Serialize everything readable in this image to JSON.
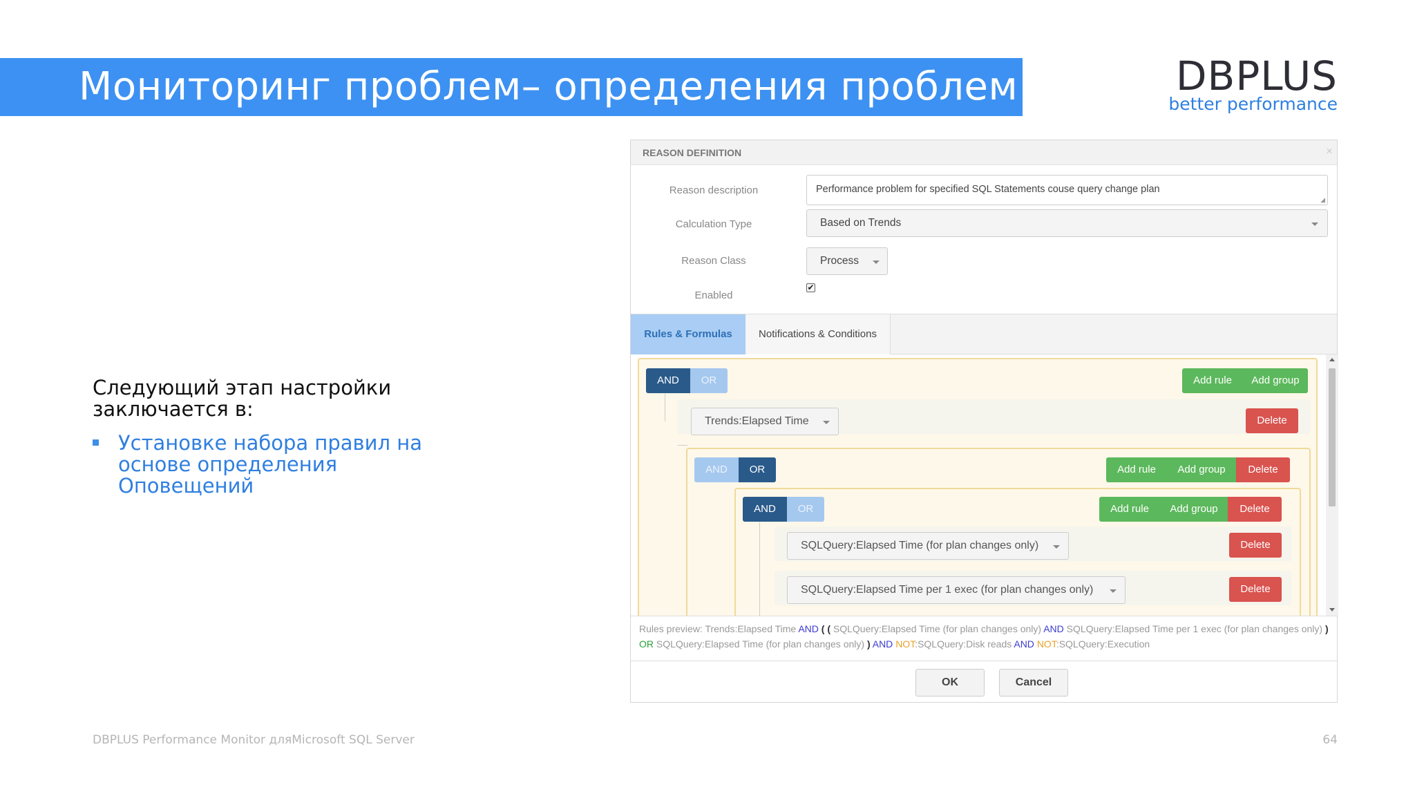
{
  "slide": {
    "title": "Мониторинг проблем– определения проблем",
    "logo_main": "DBPLUS",
    "logo_sub": "better performance",
    "intro_text": "Следующий этап настройки заключается в:",
    "bullet_text": "Установке набора правил на основе определения Оповещений",
    "footer_left": "DBPLUS Performance Monitor дляMicrosoft SQL Server",
    "page_number": "64",
    "accent_color": "#3d91f2"
  },
  "dialog": {
    "title": "REASON DEFINITION",
    "close_icon": "×",
    "fields": {
      "reason_description_label": "Reason description",
      "reason_description_value": "Performance problem for specified SQL Statements couse query change plan",
      "calculation_type_label": "Calculation Type",
      "calculation_type_value": "Based on Trends",
      "reason_class_label": "Reason Class",
      "reason_class_value": "Process",
      "enabled_label": "Enabled",
      "enabled_checked": true,
      "checkmark": "✔"
    },
    "tabs": [
      {
        "label": "Rules & Formulas",
        "active": true
      },
      {
        "label": "Notifications & Conditions",
        "active": false
      }
    ],
    "builder": {
      "root": {
        "and_label": "AND",
        "or_label": "OR",
        "active": "AND",
        "add_rule": "Add rule",
        "add_group": "Add group",
        "rule1": {
          "field": "Trends:Elapsed Time",
          "delete": "Delete"
        },
        "group1": {
          "and_label": "AND",
          "or_label": "OR",
          "active": "OR",
          "add_rule": "Add rule",
          "add_group": "Add group",
          "delete": "Delete",
          "group2": {
            "and_label": "AND",
            "or_label": "OR",
            "active": "AND",
            "add_rule": "Add rule",
            "add_group": "Add group",
            "delete": "Delete",
            "rule_a": {
              "field": "SQLQuery:Elapsed Time (for plan changes only)",
              "delete": "Delete"
            },
            "rule_b": {
              "field": "SQLQuery:Elapsed Time per 1 exec (for plan changes only)",
              "delete": "Delete"
            }
          }
        }
      }
    },
    "preview": {
      "prefix": "Rules preview: ",
      "t1": "Trends:Elapsed Time ",
      "and1": "AND",
      "p1": " ( (",
      "t2": " SQLQuery:Elapsed Time (for plan changes only) ",
      "and2": "AND",
      "t3": " SQLQuery:Elapsed Time per 1 exec (for plan changes only) ",
      "p2": ")",
      "or1": " OR",
      "t4": " SQLQuery:Elapsed Time (for plan changes only) ",
      "p3": ")",
      "and3": " AND ",
      "not1": "NOT",
      "t5": ":SQLQuery:Disk reads ",
      "and4": "AND ",
      "not2": "NOT",
      "t6": ":SQLQuery:Execution"
    },
    "ok_label": "OK",
    "cancel_label": "Cancel"
  }
}
